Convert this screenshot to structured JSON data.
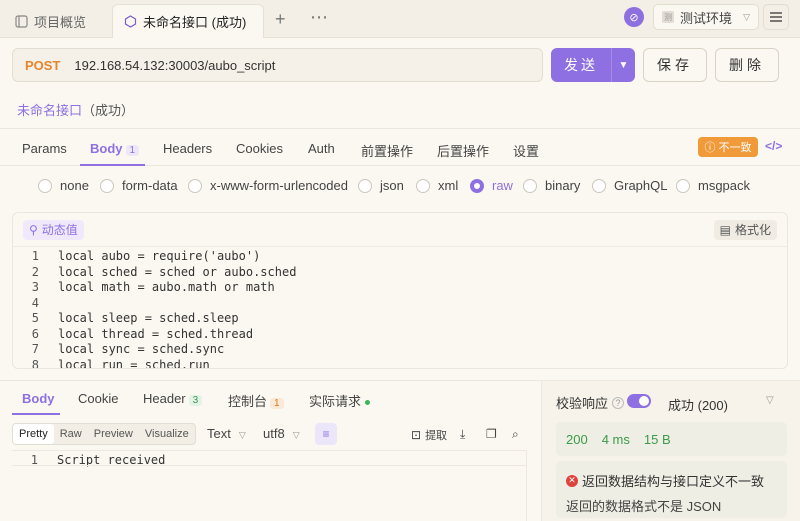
{
  "tabs": {
    "items": [
      {
        "label": "项目概览",
        "icon": "project-icon"
      },
      {
        "label": "未命名接口 (成功)",
        "icon": "api-icon"
      }
    ],
    "add_icon": "+",
    "more_icon": "⋯"
  },
  "env": {
    "label": "测试环境",
    "badge_icon": "⊘",
    "square_text": "测"
  },
  "request": {
    "method": "POST",
    "url": "192.168.54.132:30003/aubo_script",
    "send_label": "发送",
    "save_label": "保存",
    "delete_label": "删除"
  },
  "api_name": {
    "name": "未命名接口",
    "status": "（成功）"
  },
  "req_tabs": [
    {
      "label": "Params"
    },
    {
      "label": "Body",
      "count": "1"
    },
    {
      "label": "Headers"
    },
    {
      "label": "Cookies"
    },
    {
      "label": "Auth"
    },
    {
      "label": "前置操作"
    },
    {
      "label": "后置操作"
    },
    {
      "label": "设置"
    }
  ],
  "mismatch_label": "不一致",
  "code_toggle_icon": "</>",
  "body_types": [
    "none",
    "form-data",
    "x-www-form-urlencoded",
    "json",
    "xml",
    "raw",
    "binary",
    "GraphQL",
    "msgpack"
  ],
  "selected_body_type": "raw",
  "editor": {
    "dynamic_label": "动态值",
    "format_label": "格式化",
    "lines": [
      {
        "n": "1",
        "text": "local aubo = require('aubo')"
      },
      {
        "n": "2",
        "text": "local sched = sched or aubo.sched"
      },
      {
        "n": "3",
        "text": "local math = aubo.math or math"
      },
      {
        "n": "4",
        "text": ""
      },
      {
        "n": "5",
        "text": "local sleep = sched.sleep"
      },
      {
        "n": "6",
        "text": "local thread = sched.thread"
      },
      {
        "n": "7",
        "text": "local sync = sched.sync"
      },
      {
        "n": "8",
        "text": "local run = sched.run"
      }
    ]
  },
  "response": {
    "tabs": [
      {
        "label": "Body"
      },
      {
        "label": "Cookie"
      },
      {
        "label": "Header",
        "count": "3"
      },
      {
        "label": "控制台",
        "count": "1"
      },
      {
        "label": "实际请求"
      }
    ],
    "view_modes": [
      "Pretty",
      "Raw",
      "Preview",
      "Visualize"
    ],
    "selected_view": "Pretty",
    "format": "Text",
    "encoding": "utf8",
    "extract_label": "提取",
    "lines": [
      {
        "n": "1",
        "text": "Script received"
      }
    ]
  },
  "validation": {
    "label": "校验响应",
    "status": "成功 (200)",
    "code": "200",
    "time": "4 ms",
    "size": "15 B",
    "error_title": "返回数据结构与接口定义不一致",
    "error_detail": "返回的数据格式不是 JSON"
  }
}
